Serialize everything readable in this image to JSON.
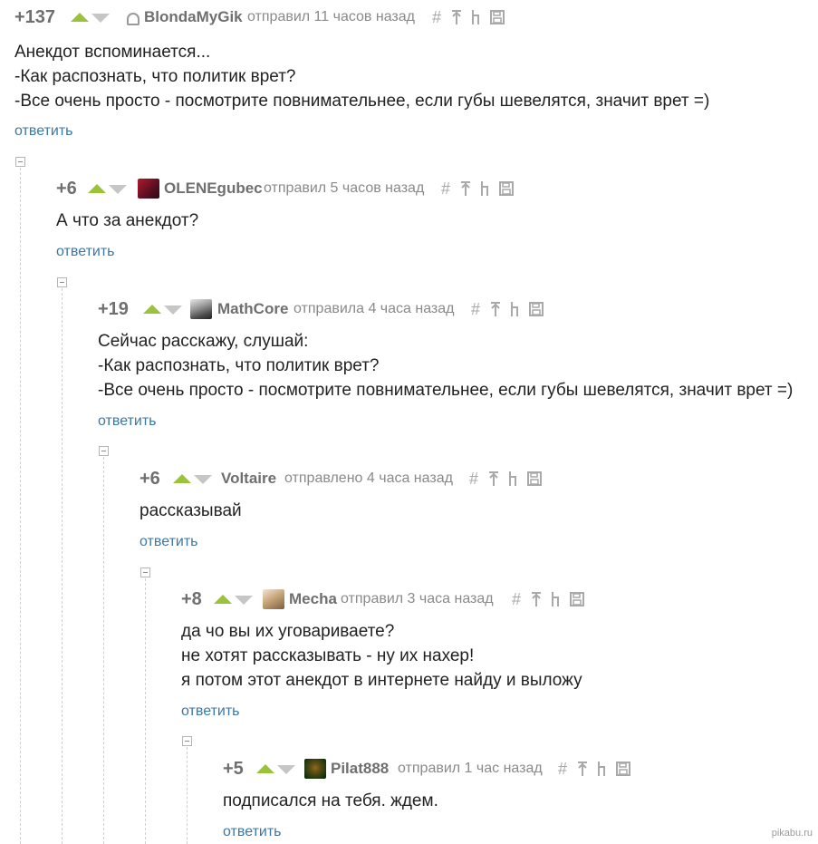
{
  "comments": [
    {
      "rating": "+137",
      "username": "BlondaMyGik",
      "action": "отправил 11 часов назад",
      "avatar": "ghost-icon",
      "lines": [
        "Анекдот вспоминается...",
        "-Как распознать, что политик врет?",
        "-Все очень просто - посмотрите повнимательнее, если губы шевелятся, значит врет =)"
      ],
      "reply": "ответить"
    },
    {
      "rating": "+6",
      "username": "OLENEgubec",
      "action": "отправил 5 часов назад",
      "avatar": "user-avatar-red",
      "lines": [
        "А что за анекдот?"
      ],
      "reply": "ответить"
    },
    {
      "rating": "+19",
      "username": "MathCore",
      "action": "отправила 4 часа назад",
      "avatar": "user-avatar-gray",
      "lines": [
        "Сейчас расскажу, слушай:",
        "-Как распознать, что политик врет?",
        "-Все очень просто - посмотрите повнимательнее, если губы шевелятся, значит врет =)"
      ],
      "reply": "ответить"
    },
    {
      "rating": "+6",
      "username": "Voltaire",
      "action": "отправлено 4 часа назад",
      "avatar": "",
      "lines": [
        "рассказывай"
      ],
      "reply": "ответить"
    },
    {
      "rating": "+8",
      "username": "Mecha",
      "action": "отправил 3 часа назад",
      "avatar": "user-avatar-beige",
      "lines": [
        "да чо вы их уговариваете?",
        "не хотят рассказывать - ну их нахер!",
        "я потом этот анекдот в интернете найду и выложу"
      ],
      "reply": "ответить"
    },
    {
      "rating": "+5",
      "username": "Pilat888",
      "action": "отправил 1 час назад",
      "avatar": "user-avatar-green",
      "lines": [
        "подписался на тебя. ждем."
      ],
      "reply": "ответить"
    }
  ],
  "tools": {
    "link": "#",
    "icons": [
      "link-icon",
      "parent-icon",
      "thread-icon",
      "save-icon"
    ]
  },
  "colors": {
    "vote_up": "#9ac23b",
    "vote_down": "#c6c6c6",
    "reply_link": "#3a78a8"
  },
  "watermark": "pikabu.ru"
}
